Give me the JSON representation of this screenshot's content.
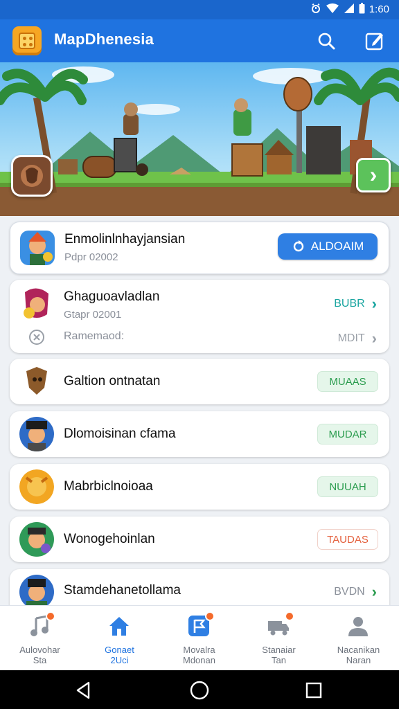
{
  "status_bar": {
    "time": "1:60",
    "icons": [
      "alarm-icon",
      "wifi-icon",
      "signal-icon",
      "battery-icon"
    ]
  },
  "app_bar": {
    "title": "MapDhenesia",
    "actions": [
      "search-icon",
      "compose-icon"
    ]
  },
  "banner": {
    "icons": [
      "left-app-icon",
      "next-arrow-icon"
    ]
  },
  "list": {
    "featured": {
      "title": "Enmolinlnhayjansian",
      "subtitle": "Pdpr 02002",
      "button_label": "ALDOAIM",
      "button_icon": "refresh-icon"
    },
    "second": {
      "title": "Ghaguoavladlan",
      "subtitle": "Gtapr 02001",
      "action_label": "BUBR",
      "row_label": "Ramemaod:",
      "row_action": "MDIT",
      "row_icon": "close-circle-icon"
    },
    "items": [
      {
        "title": "Galtion ontnatan",
        "action": "MUAAS"
      },
      {
        "title": "Dlomoisinan cfama",
        "action": "MUDAR"
      },
      {
        "title": "Mabrbiclnoioaa",
        "action": "NUUAH"
      },
      {
        "title": "Wonogehoinlan",
        "action": "TAUDAS"
      },
      {
        "title": "Stamdehanetollama",
        "action": "BVDN"
      }
    ]
  },
  "bottom_nav": [
    {
      "label1": "Aulovohar",
      "label2": "Sta",
      "icon": "music-icon",
      "badge": true
    },
    {
      "label1": "Gonaet",
      "label2": "2Uci",
      "icon": "home-icon",
      "badge": false,
      "active": true
    },
    {
      "label1": "Movalra",
      "label2": "Mdonan",
      "icon": "flag-icon",
      "badge": true
    },
    {
      "label1": "Stanaiar",
      "label2": "Tan",
      "icon": "truck-icon",
      "badge": true
    },
    {
      "label1": "Nacanikan",
      "label2": "Naran",
      "icon": "profile-icon",
      "badge": false
    }
  ],
  "colors": {
    "primary": "#1f73e0",
    "status_bar": "#1a66cc",
    "accent_green": "#2a9c4e",
    "accent_orange": "#e4603d",
    "badge": "#f46a2b"
  }
}
